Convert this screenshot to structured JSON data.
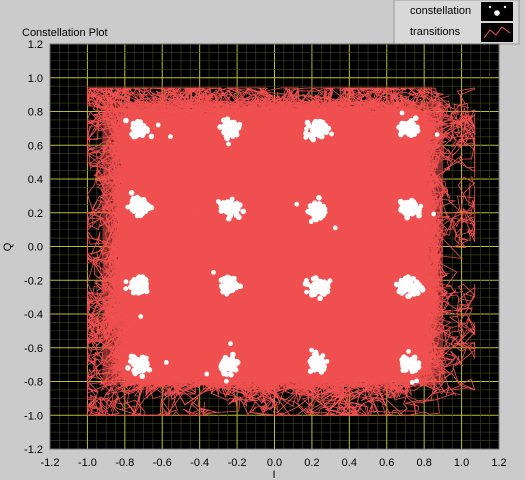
{
  "chart_data": {
    "type": "scatter",
    "title": "Constellation Plot",
    "xlabel": "I",
    "ylabel": "Q",
    "xlim": [
      -1.2,
      1.2
    ],
    "ylim": [
      -1.2,
      1.2
    ],
    "x_ticks": [
      "-1.2",
      "-1.0",
      "-0.8",
      "-0.6",
      "-0.4",
      "-0.2",
      "0.0",
      "0.2",
      "0.4",
      "0.6",
      "0.8",
      "1.0",
      "1.2"
    ],
    "y_ticks": [
      "1.2",
      "1.0",
      "0.8",
      "0.6",
      "0.4",
      "0.2",
      "0.0",
      "-0.2",
      "-0.4",
      "-0.6",
      "-0.8",
      "-1.0",
      "-1.2"
    ],
    "grid": true,
    "legend_position": "top-right",
    "background_color": "#000000",
    "grid_color": "#bdbd2a",
    "series": [
      {
        "name": "constellation",
        "color": "#ffffff",
        "marker": "dot",
        "cluster_centers": [
          [
            -0.72,
            0.7
          ],
          [
            -0.24,
            0.7
          ],
          [
            0.23,
            0.7
          ],
          [
            0.72,
            0.7
          ],
          [
            -0.72,
            0.24
          ],
          [
            -0.24,
            0.23
          ],
          [
            0.23,
            0.21
          ],
          [
            0.72,
            0.22
          ],
          [
            -0.72,
            -0.23
          ],
          [
            -0.24,
            -0.23
          ],
          [
            0.23,
            -0.24
          ],
          [
            0.72,
            -0.24
          ],
          [
            -0.72,
            -0.7
          ],
          [
            -0.24,
            -0.7
          ],
          [
            0.23,
            -0.7
          ],
          [
            0.72,
            -0.7
          ]
        ]
      },
      {
        "name": "transitions",
        "color": "#f05050",
        "marker": "line",
        "x_extent": [
          -1.0,
          1.07
        ],
        "y_extent": [
          -1.0,
          0.94
        ]
      }
    ]
  }
}
